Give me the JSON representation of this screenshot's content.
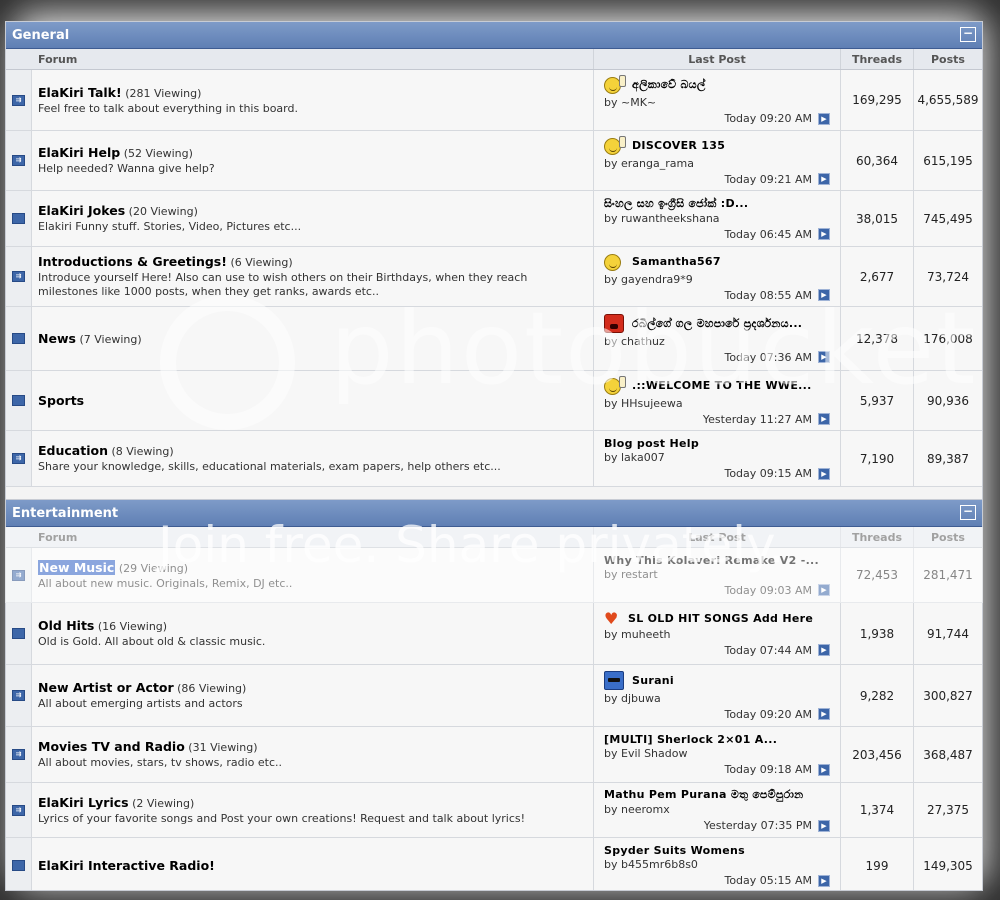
{
  "general": {
    "title": "General",
    "collapse": "−",
    "headers": {
      "forum": "Forum",
      "last_post": "Last Post",
      "threads": "Threads",
      "posts": "Posts"
    },
    "rows": [
      {
        "title": "ElaKiri Talk!",
        "viewing": "(281 Viewing)",
        "desc": "Feel free to talk about everything in this board.",
        "lp_title": "අලිකාවේ බයල්",
        "lp_user": "~MK~",
        "lp_time": "Today 09:20 AM",
        "threads": "169,295",
        "posts": "4,655,589",
        "icon": "smile-thumb-icon"
      },
      {
        "title": "ElaKiri Help",
        "viewing": "(52 Viewing)",
        "desc": "Help needed? Wanna give help?",
        "lp_title": "DISCOVER 135",
        "lp_user": "eranga_rama",
        "lp_time": "Today 09:21 AM",
        "threads": "60,364",
        "posts": "615,195",
        "icon": "smile-thumb-icon"
      },
      {
        "title": "ElaKiri Jokes",
        "viewing": "(20 Viewing)",
        "desc": "Elakiri Funny stuff. Stories, Video, Pictures etc...",
        "lp_title": "සිංහල සහ ඉංග්‍රීසි ජෝක් :D...",
        "lp_user": "ruwantheekshana",
        "lp_time": "Today 06:45 AM",
        "threads": "38,015",
        "posts": "745,495",
        "icon": ""
      },
      {
        "title": "Introductions & Greetings!",
        "viewing": "(6 Viewing)",
        "desc": "Introduce yourself Here! Also can use to wish others on their Birthdays, when they reach milestones like 1000 posts, when they get ranks, awards etc..",
        "lp_title": "Samantha567",
        "lp_user": "gayendra9*9",
        "lp_time": "Today 08:55 AM",
        "threads": "2,677",
        "posts": "73,724",
        "icon": "smile-icon"
      },
      {
        "title": "News",
        "viewing": "(7 Viewing)",
        "desc": "",
        "lp_title": "රබිල්ගේ ගල මහපාරේ ප්‍රදර්ශනය...",
        "lp_user": "chathuz",
        "lp_time": "Today 07:36 AM",
        "threads": "12,378",
        "posts": "176,008",
        "icon": "angry-icon"
      },
      {
        "title": "Sports",
        "viewing": "",
        "desc": "",
        "lp_title": ".::WELCOME TO THE WWE...",
        "lp_user": "HHsujeewa",
        "lp_time": "Yesterday 11:27 AM",
        "threads": "5,937",
        "posts": "90,936",
        "icon": "smile-thumb-icon"
      },
      {
        "title": "Education",
        "viewing": "(8 Viewing)",
        "desc": "Share your knowledge, skills, educational materials, exam papers, help others etc...",
        "lp_title": "Blog post Help",
        "lp_user": "laka007",
        "lp_time": "Today 09:15 AM",
        "threads": "7,190",
        "posts": "89,387",
        "icon": ""
      }
    ]
  },
  "entertainment": {
    "title": "Entertainment",
    "collapse": "−",
    "headers": {
      "forum": "Forum",
      "last_post": "Last Post",
      "threads": "Threads",
      "posts": "Posts"
    },
    "rows": [
      {
        "title": "New Music",
        "viewing": "(29 Viewing)",
        "desc": "All about new music. Originals, Remix, DJ etc..",
        "lp_title": "Why This Kolaveri Remake V2 -...",
        "lp_user": "restart",
        "lp_time": "Today 09:03 AM",
        "threads": "72,453",
        "posts": "281,471",
        "icon": ""
      },
      {
        "title": "Old Hits",
        "viewing": "(16 Viewing)",
        "desc": "Old is Gold. All about old & classic music.",
        "lp_title": "SL OLD HIT SONGS Add Here",
        "lp_user": "muheeth",
        "lp_time": "Today 07:44 AM",
        "threads": "1,938",
        "posts": "91,744",
        "icon": "heart-icon"
      },
      {
        "title": "New Artist or Actor",
        "viewing": "(86 Viewing)",
        "desc": "All about emerging artists and actors",
        "lp_title": "Surani",
        "lp_user": "djbuwa",
        "lp_time": "Today 09:20 AM",
        "threads": "9,282",
        "posts": "300,827",
        "icon": "cool-icon"
      },
      {
        "title": "Movies TV and Radio",
        "viewing": "(31 Viewing)",
        "desc": "All about movies, stars, tv shows, radio etc..",
        "lp_title": "[MULTI] Sherlock 2×01 A...",
        "lp_user": "Evil Shadow",
        "lp_time": "Today 09:18 AM",
        "threads": "203,456",
        "posts": "368,487",
        "icon": ""
      },
      {
        "title": "ElaKiri Lyrics",
        "viewing": "(2 Viewing)",
        "desc": "Lyrics of your favorite songs and Post your own creations! Request and talk about lyrics!",
        "lp_title": "Mathu Pem Purana මතු පෙම්පුරාන",
        "lp_user": "neeromx",
        "lp_time": "Yesterday 07:35 PM",
        "threads": "1,374",
        "posts": "27,375",
        "icon": ""
      },
      {
        "title": "ElaKiri Interactive Radio!",
        "viewing": "",
        "desc": "",
        "lp_title": "Spyder Suits Womens",
        "lp_user": "b455mr6b8s0",
        "lp_time": "Today 05:15 AM",
        "threads": "199",
        "posts": "149,305",
        "icon": ""
      }
    ]
  },
  "by_label": "by",
  "watermark": {
    "brand": "photobucket",
    "tagline": "Join free. Share privately."
  }
}
